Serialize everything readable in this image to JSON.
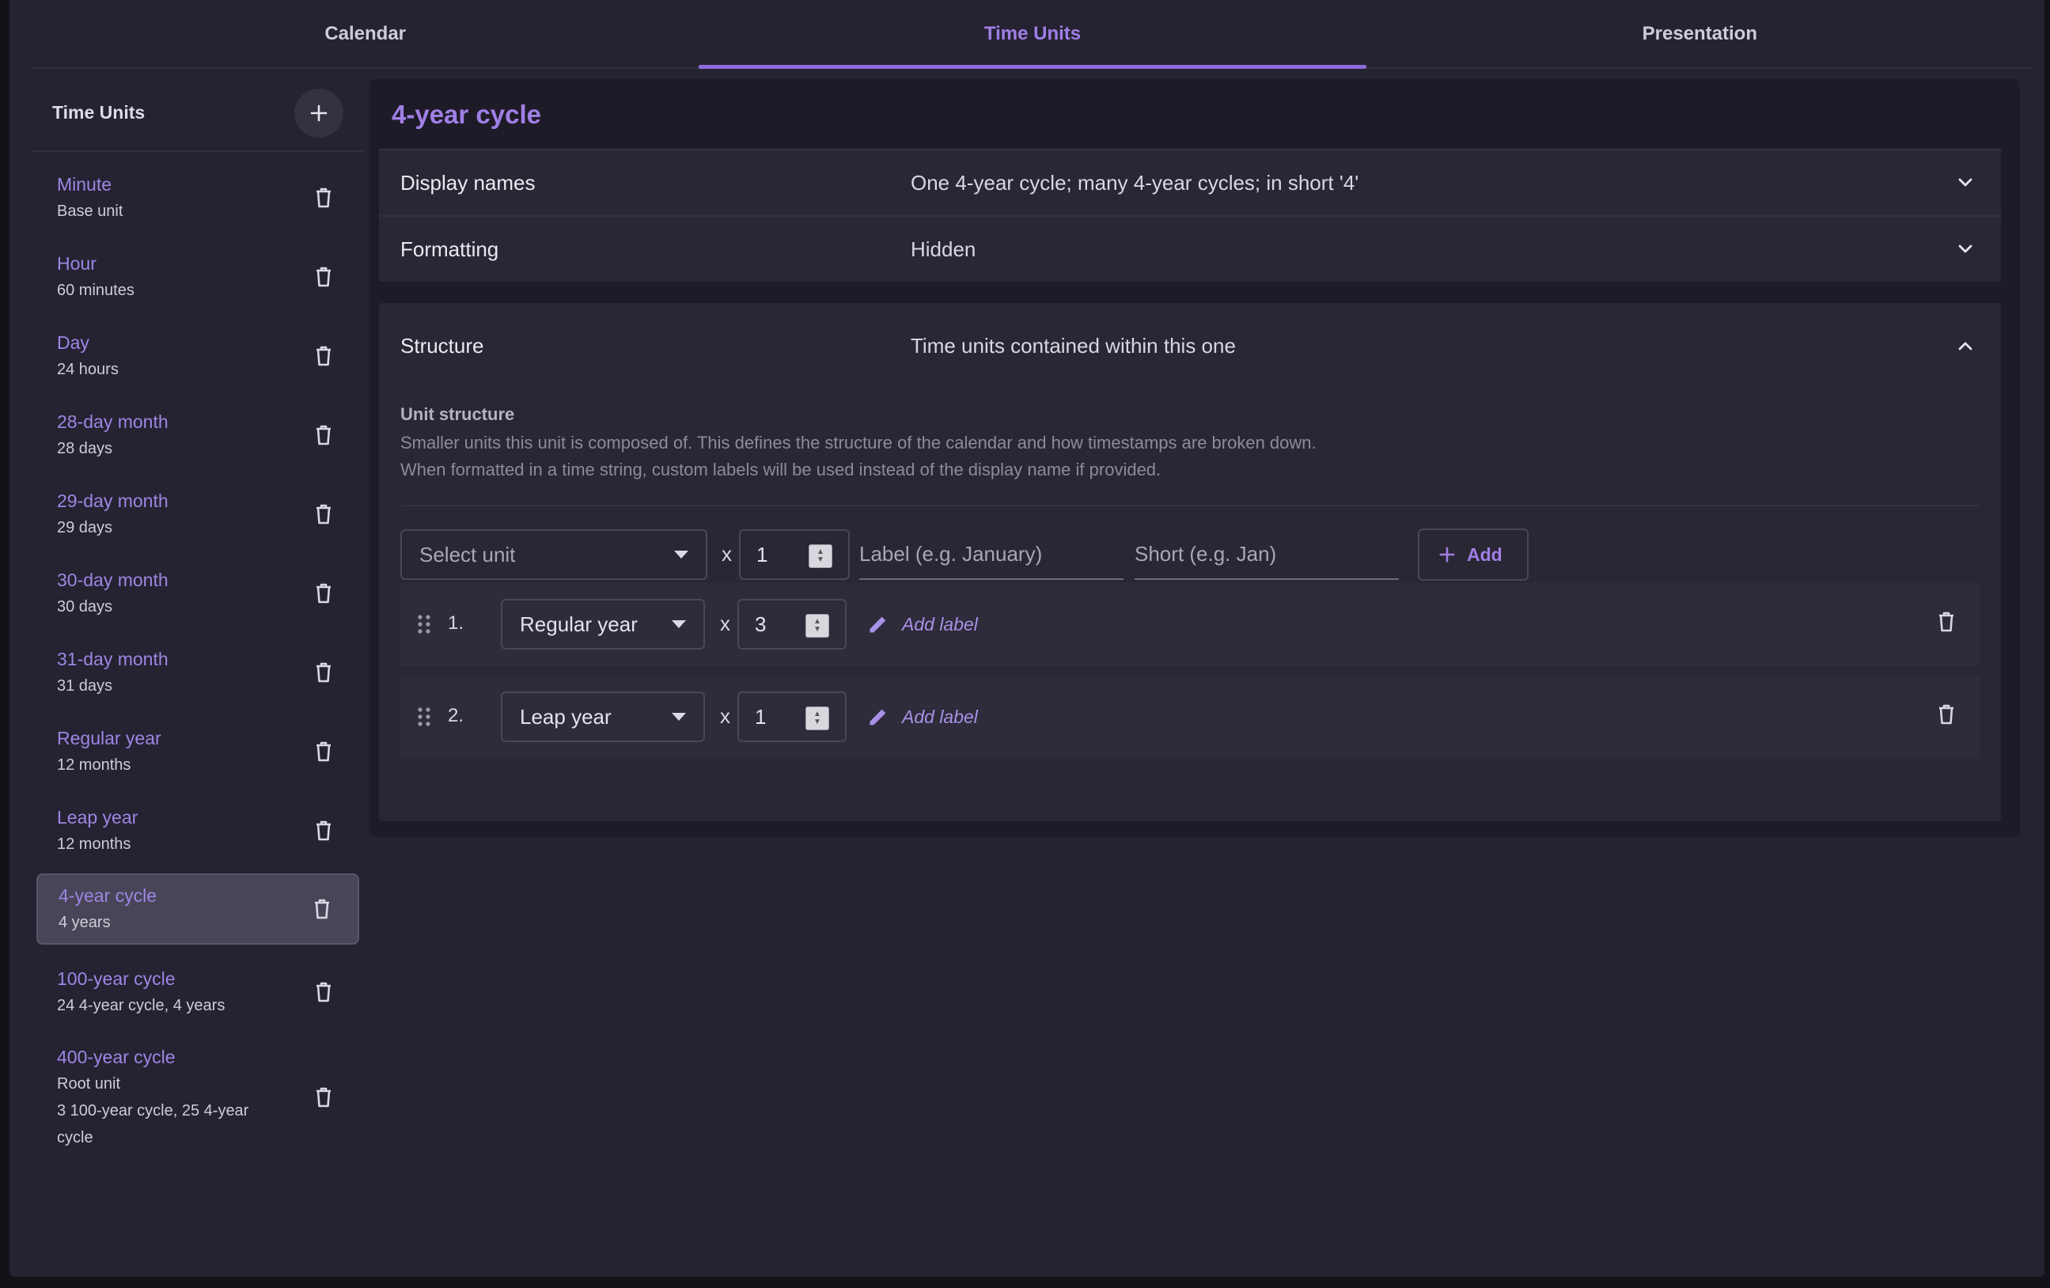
{
  "tabs": [
    {
      "label": "Calendar"
    },
    {
      "label": "Time Units"
    },
    {
      "label": "Presentation"
    }
  ],
  "active_tab": "Time Units",
  "colors": {
    "accent": "#a07fe6",
    "background": "#252232",
    "panel": "#2a2735"
  },
  "sidebar": {
    "title": "Time Units",
    "add_icon": "plus-icon",
    "items": [
      {
        "name": "Minute",
        "sub": [
          "Base unit"
        ]
      },
      {
        "name": "Hour",
        "sub": [
          "60 minutes"
        ]
      },
      {
        "name": "Day",
        "sub": [
          "24 hours"
        ]
      },
      {
        "name": "28-day month",
        "sub": [
          "28 days"
        ]
      },
      {
        "name": "29-day month",
        "sub": [
          "29 days"
        ]
      },
      {
        "name": "30-day month",
        "sub": [
          "30 days"
        ]
      },
      {
        "name": "31-day month",
        "sub": [
          "31 days"
        ]
      },
      {
        "name": "Regular year",
        "sub": [
          "12 months"
        ]
      },
      {
        "name": "Leap year",
        "sub": [
          "12 months"
        ]
      },
      {
        "name": "4-year cycle",
        "sub": [
          "4 years"
        ],
        "selected": true
      },
      {
        "name": "100-year cycle",
        "sub": [
          "24 4-year cycle, 4 years"
        ]
      },
      {
        "name": "400-year cycle",
        "sub": [
          "Root unit",
          "3 100-year cycle, 25 4-year",
          "cycle"
        ]
      }
    ]
  },
  "main": {
    "title": "4-year cycle",
    "display_names": {
      "label": "Display names",
      "value": "One 4-year cycle; many 4-year cycles; in short '4'"
    },
    "formatting": {
      "label": "Formatting",
      "value": "Hidden"
    },
    "structure": {
      "label": "Structure",
      "value": "Time units contained within this one",
      "unit_structure_title": "Unit structure",
      "desc_line1": "Smaller units this unit is composed of. This defines the structure of the calendar and how timestamps are broken down.",
      "desc_line2": "When formatted in a time string, custom labels will be used instead of the display name if provided.",
      "new_entry": {
        "select_placeholder": "Select unit",
        "times": "x",
        "count": "1",
        "label_placeholder": "Label (e.g. January)",
        "short_placeholder": "Short (e.g. Jan)",
        "add_label": "Add"
      },
      "entries": [
        {
          "index": "1.",
          "unit": "Regular year",
          "times": "x",
          "count": "3",
          "add_label": "Add label"
        },
        {
          "index": "2.",
          "unit": "Leap year",
          "times": "x",
          "count": "1",
          "add_label": "Add label"
        }
      ]
    }
  }
}
